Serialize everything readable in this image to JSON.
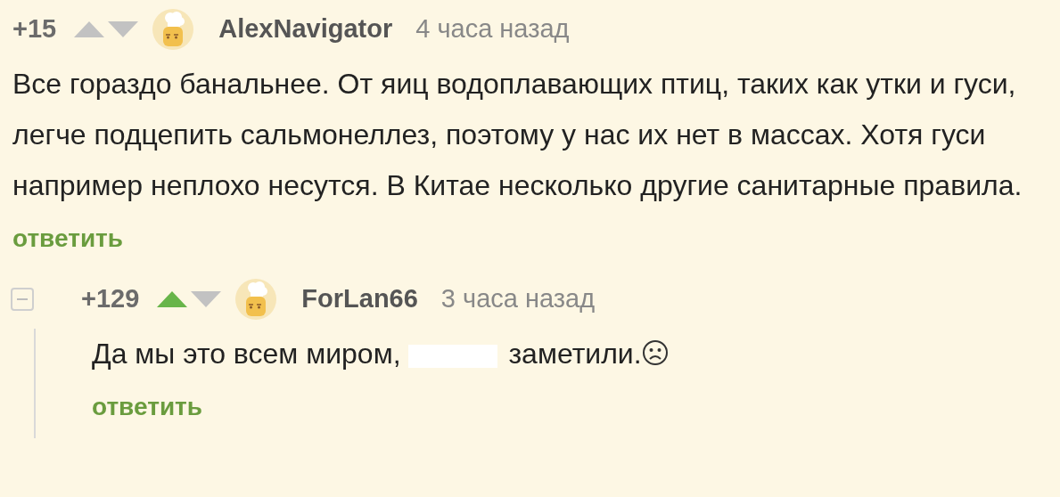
{
  "comments": [
    {
      "rating": "+15",
      "upvoted": false,
      "downvoted": false,
      "author": "AlexNavigator",
      "time": "4 часа назад",
      "body": [
        {
          "kind": "text",
          "text": "Все гораздо банальнее. От яиц водоплавающих птиц, таких как утки и гуси, легче подцепить сальмонеллез, поэтому у нас их нет в массах. Хотя гуси например неплохо несутся. В Китае несколько другие санитарные правила."
        }
      ],
      "reply": "ответить",
      "children": [
        {
          "rating": "+129",
          "upvoted": true,
          "downvoted": false,
          "author": "ForLan66",
          "time": "3 часа назад",
          "expanded": true,
          "body": [
            {
              "kind": "text",
              "text": "Да мы это всем миром,"
            },
            {
              "kind": "spoiler"
            },
            {
              "kind": "text",
              "text": "заметили."
            },
            {
              "kind": "emoji"
            }
          ],
          "reply": "ответить"
        }
      ]
    }
  ]
}
